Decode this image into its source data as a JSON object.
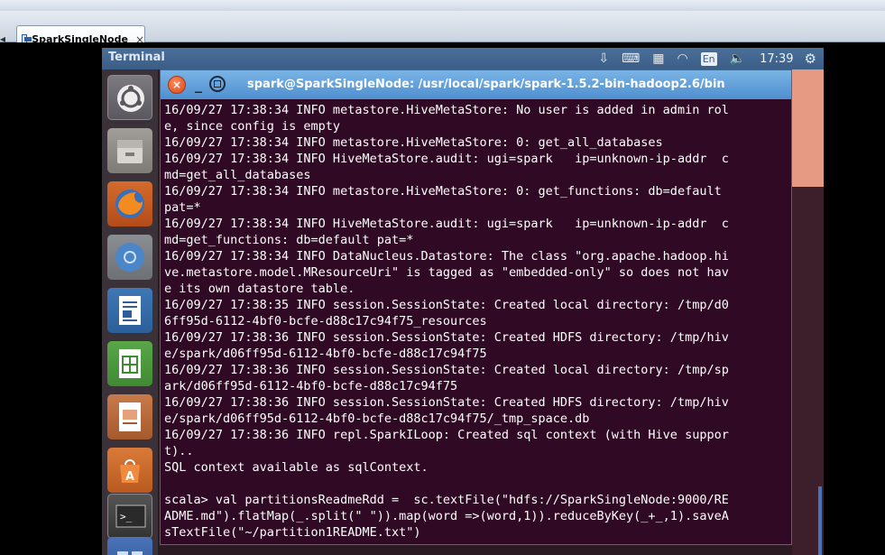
{
  "host": {
    "tab_label": "SparkSingleNode",
    "tab_close": "×"
  },
  "panel": {
    "title": "Terminal",
    "language": "En",
    "clock": "17:39"
  },
  "terminal": {
    "window_title": "spark@SparkSingleNode: /usr/local/spark/spark-1.5.2-bin-hadoop2.6/bin",
    "lines": [
      "16/09/27 17:38:34 INFO metastore.HiveMetaStore: No user is added in admin rol",
      "e, since config is empty",
      "16/09/27 17:38:34 INFO metastore.HiveMetaStore: 0: get_all_databases",
      "16/09/27 17:38:34 INFO HiveMetaStore.audit: ugi=spark   ip=unknown-ip-addr  c",
      "md=get_all_databases",
      "16/09/27 17:38:34 INFO metastore.HiveMetaStore: 0: get_functions: db=default",
      "pat=*",
      "16/09/27 17:38:34 INFO HiveMetaStore.audit: ugi=spark   ip=unknown-ip-addr  c",
      "md=get_functions: db=default pat=*",
      "16/09/27 17:38:34 INFO DataNucleus.Datastore: The class \"org.apache.hadoop.hi",
      "ve.metastore.model.MResourceUri\" is tagged as \"embedded-only\" so does not hav",
      "e its own datastore table.",
      "16/09/27 17:38:35 INFO session.SessionState: Created local directory: /tmp/d0",
      "6ff95d-6112-4bf0-bcfe-d88c17c94f75_resources",
      "16/09/27 17:38:36 INFO session.SessionState: Created HDFS directory: /tmp/hiv",
      "e/spark/d06ff95d-6112-4bf0-bcfe-d88c17c94f75",
      "16/09/27 17:38:36 INFO session.SessionState: Created local directory: /tmp/sp",
      "ark/d06ff95d-6112-4bf0-bcfe-d88c17c94f75",
      "16/09/27 17:38:36 INFO session.SessionState: Created HDFS directory: /tmp/hiv",
      "e/spark/d06ff95d-6112-4bf0-bcfe-d88c17c94f75/_tmp_space.db",
      "16/09/27 17:38:36 INFO repl.SparkILoop: Created sql context (with Hive suppor",
      "t)..",
      "SQL context available as sqlContext.",
      "",
      "scala> val partitionsReadmeRdd =  sc.textFile(\"hdfs://SparkSingleNode:9000/RE",
      "ADME.md\").flatMap(_.split(\" \")).map(word =>(word,1)).reduceByKey(_+_,1).saveA",
      "sTextFile(\"~/partition1README.txt\")"
    ]
  },
  "icons": {
    "panel": [
      "download-icon",
      "keyboard-icon",
      "keyboard-layout-icon",
      "wifi-icon",
      "volume-icon",
      "gear-icon"
    ],
    "launcher": [
      "ubuntu-dash-icon",
      "files-icon",
      "firefox-icon",
      "chromium-icon",
      "writer-icon",
      "calc-icon",
      "impress-icon",
      "software-center-icon",
      "terminal-icon",
      "workspace-switcher-icon"
    ]
  },
  "colors": {
    "terminal_bg": "#300a24",
    "title_blue": "#5c9ad6",
    "panel_blue": "#41658f"
  }
}
